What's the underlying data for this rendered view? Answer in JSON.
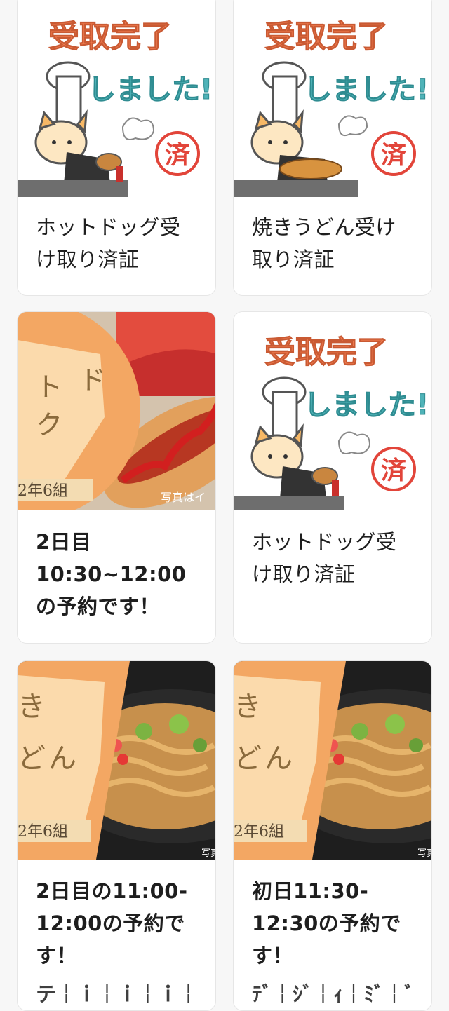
{
  "cards": [
    {
      "stamp": {
        "line1": "受取完了",
        "line2": "しました!",
        "seal": "済"
      },
      "caption": "ホットドッグ受け取り済証"
    },
    {
      "stamp": {
        "line1": "受取完了",
        "line2": "しました!",
        "seal": "済"
      },
      "caption": "焼きうどん受け取り済証"
    },
    {
      "photo": {
        "text_a": "ト",
        "text_b": "ド",
        "text_c": "ク",
        "class_label": "2年6組",
        "note": "写真はイ"
      },
      "caption": "2日目10:30~12:00の予約です！"
    },
    {
      "stamp": {
        "line1": "受取完了",
        "line2": "しました!",
        "seal": "済"
      },
      "caption": "ホットドッグ受け取り済証"
    },
    {
      "photo": {
        "text_a": "き",
        "text_b": "ど",
        "text_c": "ん",
        "class_label": "2年6組",
        "note": "写真"
      },
      "caption": "2日目の11:00-12:00の予約です！",
      "cut_text": "テ￤ｉ￤ｉ￤ｉ￤ｉ￤ﾀﾞｨｽﾞ￤ｼﾞ￤ｨ"
    },
    {
      "photo": {
        "text_a": "き",
        "text_b": "ど",
        "text_c": "ん",
        "class_label": "2年6組",
        "note": "写真"
      },
      "caption": "初日11:30-12:30の予約です！",
      "cut_text": "ﾃﾞ￤ｼﾞ￤ｨ￤ﾐﾞ￤ﾞ"
    }
  ],
  "colors": {
    "stamp_orange": "#f07a4e",
    "stamp_teal": "#4fb3b8",
    "seal_red": "#e2453a",
    "photo_orange": "#f3a763",
    "card_border": "#e6e6e6"
  }
}
